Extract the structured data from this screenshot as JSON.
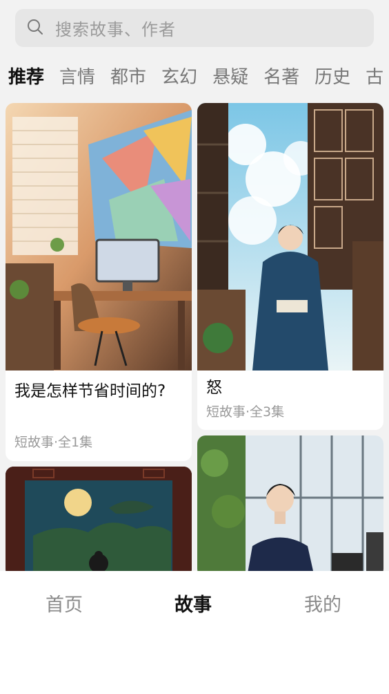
{
  "search": {
    "placeholder": "搜索故事、作者",
    "icon": "search-icon"
  },
  "tabs": [
    {
      "label": "推荐",
      "active": true
    },
    {
      "label": "言情"
    },
    {
      "label": "都市"
    },
    {
      "label": "玄幻"
    },
    {
      "label": "悬疑"
    },
    {
      "label": "名著"
    },
    {
      "label": "历史"
    },
    {
      "label": "古"
    }
  ],
  "cards": [
    {
      "title": "我是怎样节省时间的?",
      "meta": "短故事·全1集",
      "image": "office-desk-window-illustration"
    },
    {
      "title": "怒",
      "meta": "短故事·全3集",
      "image": "man-in-hanfu-reading-illustration"
    },
    {
      "image": "moon-night-window-illustration"
    },
    {
      "image": "man-by-office-window-illustration"
    }
  ],
  "nav": {
    "home": "首页",
    "story": "故事",
    "mine": "我的",
    "active": "story"
  },
  "colors": {
    "background": "#f2f2f2",
    "search_bg": "#e6e6e6",
    "active_text": "#111111",
    "inactive_text": "#8a8a8a",
    "meta_text": "#999999"
  }
}
